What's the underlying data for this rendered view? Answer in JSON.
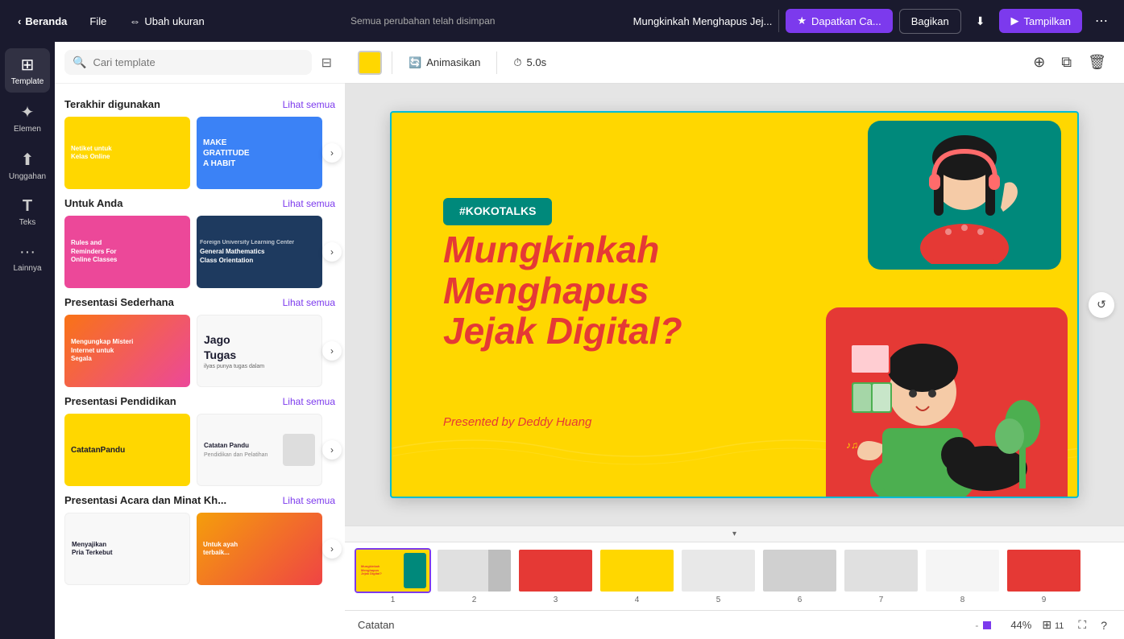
{
  "topbar": {
    "beranda_label": "Beranda",
    "file_label": "File",
    "ubah_ukuran_label": "Ubah ukuran",
    "autosave_label": "Semua perubahan telah disimpan",
    "title": "Mungkinkah Menghapus Jej...",
    "dapatkan_label": "Dapatkan Ca...",
    "bagikan_label": "Bagikan",
    "tampilkan_label": "Tampilkan"
  },
  "sidebar": {
    "items": [
      {
        "label": "Template",
        "icon": "⊞"
      },
      {
        "label": "Elemen",
        "icon": "✦"
      },
      {
        "label": "Unggahan",
        "icon": "⬆"
      },
      {
        "label": "Teks",
        "icon": "T"
      },
      {
        "label": "Lainnya",
        "icon": "···"
      }
    ]
  },
  "template_panel": {
    "search_placeholder": "Cari template",
    "sections": [
      {
        "title": "Terakhir digunakan",
        "see_all": "Lihat semua",
        "items": [
          {
            "label": "Netiket untuk Kelas Online",
            "bg": "yellow"
          },
          {
            "label": "Make Gratitude A Habit",
            "bg": "blue"
          }
        ]
      },
      {
        "title": "Untuk Anda",
        "see_all": "Lihat semua",
        "items": [
          {
            "label": "Rules and Reminders For Online Classes",
            "bg": "pink"
          },
          {
            "label": "General Mathematics Class Orientation",
            "bg": "dark-blue"
          }
        ]
      },
      {
        "title": "Presentasi Sederhana",
        "see_all": "Lihat semua",
        "items": [
          {
            "label": "Mengungkap Misteri Internet untuk Segala",
            "bg": "gradient"
          },
          {
            "label": "Jago Tugas",
            "bg": "white"
          }
        ]
      },
      {
        "title": "Presentasi Pendidikan",
        "see_all": "Lihat semua",
        "items": [
          {
            "label": "CatatanPandu",
            "bg": "yellow"
          },
          {
            "label": "Catatan Pandu",
            "bg": "white"
          }
        ]
      },
      {
        "title": "Presentasi Acara dan Minat Kh...",
        "see_all": "Lihat semua",
        "items": [
          {
            "label": "Menyajikan Pria Terkebut",
            "bg": "white"
          },
          {
            "label": "Untuk ayah terbaik...",
            "bg": "orange"
          }
        ]
      }
    ]
  },
  "canvas": {
    "color_swatch": "#FFD700",
    "animation_label": "Animasikan",
    "duration_label": "5.0s",
    "slide": {
      "hashtag": "#KOKOTALKS",
      "title_line1": "Mungkinkah",
      "title_line2": "Menghapus",
      "title_line3": "Jejak Digital?",
      "subtitle": "Presented by Deddy Huang"
    }
  },
  "filmstrip": {
    "slides": [
      {
        "number": "1",
        "active": true,
        "color": "yellow"
      },
      {
        "number": "2",
        "active": false,
        "color": "gray"
      },
      {
        "number": "3",
        "active": false,
        "color": "red"
      },
      {
        "number": "4",
        "active": false,
        "color": "lightred"
      },
      {
        "number": "5",
        "active": false,
        "color": "green"
      },
      {
        "number": "6",
        "active": false,
        "color": "white"
      },
      {
        "number": "7",
        "active": false,
        "color": "white"
      },
      {
        "number": "8",
        "active": false,
        "color": "white"
      },
      {
        "number": "9",
        "active": false,
        "color": "dark"
      }
    ]
  },
  "bottom_bar": {
    "notes_label": "Catatan",
    "zoom_value": "44%",
    "slide_count": "11"
  }
}
